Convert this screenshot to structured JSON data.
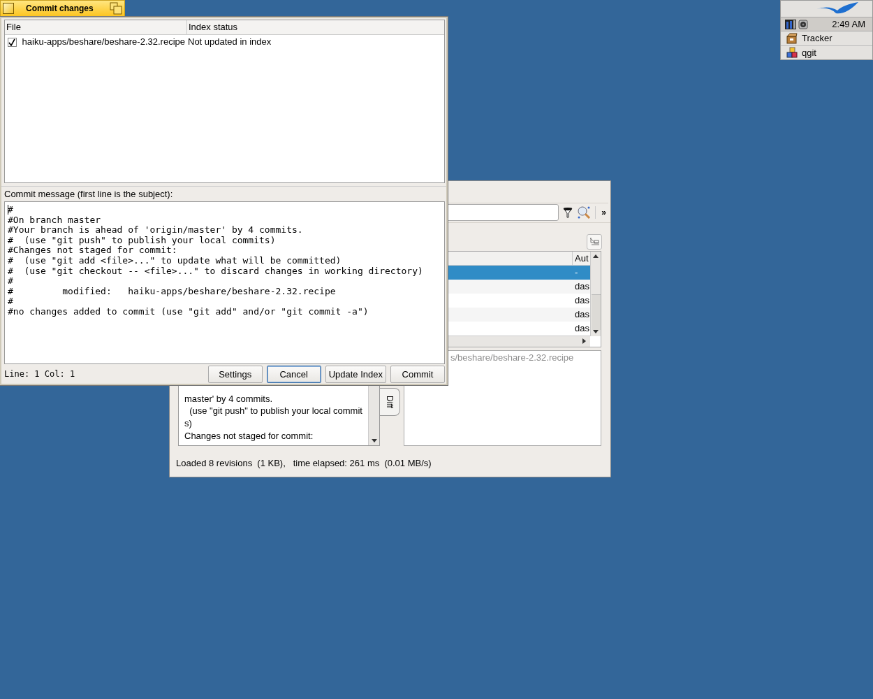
{
  "deskbar": {
    "clock": "2:49 AM",
    "apps": [
      {
        "label": "Tracker",
        "kind": "tracker"
      },
      {
        "label": "qgit",
        "kind": "qgit"
      }
    ]
  },
  "main_window": {
    "more_button": "»",
    "table": {
      "columns": [
        "Aut"
      ],
      "rows": [
        {
          "author": "-",
          "selected": true
        },
        {
          "author": "das",
          "selected": false
        },
        {
          "author": "das",
          "selected": false
        },
        {
          "author": "das",
          "selected": false
        },
        {
          "author": "das",
          "selected": false
        }
      ]
    },
    "log_lines": [
      "master' by 4 commits.",
      "  (use \"git push\" to publish your local commit",
      "s)",
      "Changes not staged for commit:"
    ],
    "diff_tab": "Diff",
    "file_path": "s/beshare/beshare-2.32.recipe",
    "status_bar": "Loaded 8 revisions  (1 KB),   time elapsed: 261 ms  (0.01 MB/s)"
  },
  "commit_dialog": {
    "title": "Commit changes",
    "files": {
      "columns": [
        "File",
        "Index status"
      ],
      "rows": [
        {
          "checked": true,
          "file": "haiku-apps/beshare/beshare-2.32.recipe",
          "status": "Not updated in index"
        }
      ]
    },
    "message_label": "Commit message (first line is the subject):",
    "message": "#\n#On branch master\n#Your branch is ahead of 'origin/master' by 4 commits.\n#  (use \"git push\" to publish your local commits)\n#Changes not staged for commit:\n#  (use \"git add <file>...\" to update what will be committed)\n#  (use \"git checkout -- <file>...\" to discard changes in working directory)\n#\n#         modified:   haiku-apps/beshare/beshare-2.32.recipe\n#\n#no changes added to commit (use \"git add\" and/or \"git commit -a\")",
    "cursor_position": "Line: 1 Col: 1",
    "buttons": [
      {
        "label": "Settings",
        "focused": false
      },
      {
        "label": "Cancel",
        "focused": true
      },
      {
        "label": "Update Index",
        "focused": false
      },
      {
        "label": "Commit",
        "focused": false
      }
    ]
  }
}
